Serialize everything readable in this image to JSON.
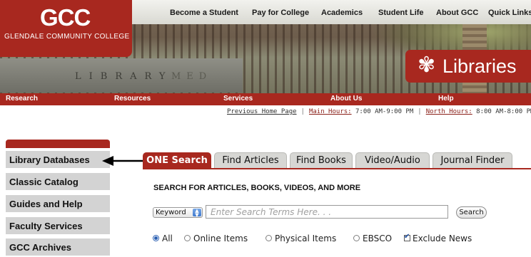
{
  "header": {
    "logo_mark": "GCC",
    "college_name": "GLENDALE COMMUNITY COLLEGE",
    "libraries_title": "Libraries",
    "libraries_icon": "palm-tree-icon",
    "top_nav": [
      "Become a Student",
      "Pay for College",
      "Academics",
      "Student Life",
      "About GCC",
      "Quick Links"
    ],
    "building_sign": "LIBRARY",
    "building_sign_partial": "MED"
  },
  "red_nav": [
    "Research",
    "Resources",
    "Services",
    "About Us",
    "Help"
  ],
  "hours": {
    "previous_home": "Previous Home Page",
    "main_label": "Main Hours:",
    "main_value": " 7:00 AM-9:00 PM",
    "north_label": "North Hours:",
    "north_value": " 8:00 AM-8:00 PM"
  },
  "sidebar": {
    "items": [
      {
        "label": "Library Databases"
      },
      {
        "label": "Classic Catalog"
      },
      {
        "label": "Guides and Help"
      },
      {
        "label": "Faculty Services"
      },
      {
        "label": "GCC Archives"
      }
    ]
  },
  "tabs": [
    {
      "label": "ONE Search",
      "active": true
    },
    {
      "label": "Find Articles",
      "active": false
    },
    {
      "label": "Find Books",
      "active": false
    },
    {
      "label": "Video/Audio",
      "active": false
    },
    {
      "label": "Journal Finder",
      "active": false
    }
  ],
  "search": {
    "heading": "SEARCH FOR ARTICLES, BOOKS, VIDEOS, AND MORE",
    "field_select": "Keyword",
    "placeholder": "Enter Search Terms Here. . .",
    "button": "Search"
  },
  "filters": [
    {
      "label": "All",
      "type": "radio",
      "checked": true
    },
    {
      "label": "Online Items",
      "type": "radio",
      "checked": false
    },
    {
      "label": "Physical Items",
      "type": "radio",
      "checked": false
    },
    {
      "label": "EBSCO",
      "type": "radio",
      "checked": false
    },
    {
      "label": "Exclude News",
      "type": "checkbox",
      "checked": true
    }
  ],
  "colors": {
    "brand_red": "#a8281f",
    "sidebar_gray": "#d3d3d3",
    "tab_gray": "#d7d7d4",
    "radio_blue": "#2a5fb2"
  }
}
